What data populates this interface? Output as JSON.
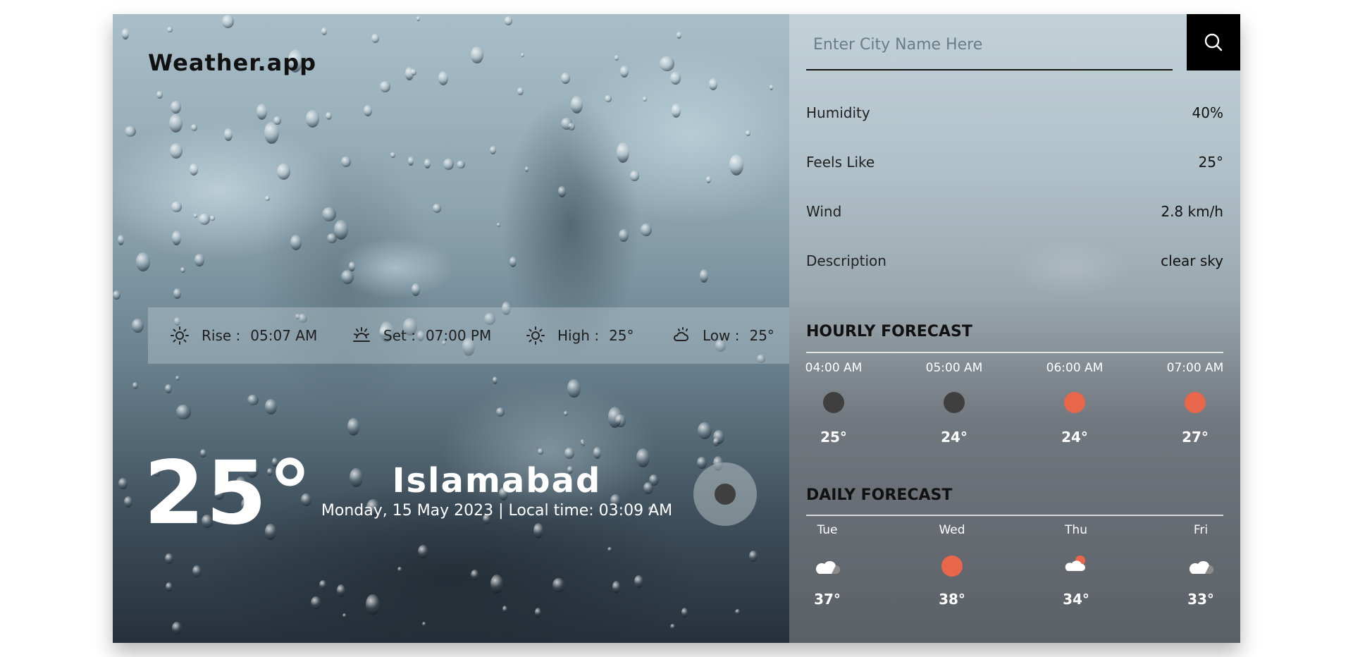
{
  "app": {
    "brand": "Weather.app"
  },
  "search": {
    "placeholder": "Enter City Name Here",
    "button_icon": "search-icon"
  },
  "stats": {
    "rise_label": "Rise :",
    "rise_value": "05:07 AM",
    "set_label": "Set :",
    "set_value": "07:00 PM",
    "high_label": "High :",
    "high_value": "25°",
    "low_label": "Low :",
    "low_value": "25°"
  },
  "current": {
    "temperature": "25°",
    "city": "Islamabad",
    "datetime": "Monday, 15 May 2023 | Local time: 03:09 AM",
    "icon": "dark-dot-icon"
  },
  "details": [
    {
      "label": "Humidity",
      "value": "40%"
    },
    {
      "label": "Feels Like",
      "value": "25°"
    },
    {
      "label": "Wind",
      "value": "2.8 km/h"
    },
    {
      "label": "Description",
      "value": "clear sky"
    }
  ],
  "hourly": {
    "title": "HOURLY FORECAST",
    "items": [
      {
        "time": "04:00 AM",
        "temp": "25°",
        "icon": "dark-dot"
      },
      {
        "time": "05:00 AM",
        "temp": "24°",
        "icon": "dark-dot"
      },
      {
        "time": "06:00 AM",
        "temp": "24°",
        "icon": "sun-dot"
      },
      {
        "time": "07:00 AM",
        "temp": "27°",
        "icon": "sun-dot"
      }
    ]
  },
  "daily": {
    "title": "DAILY FORECAST",
    "items": [
      {
        "day": "Tue",
        "temp": "37°",
        "icon": "cloud"
      },
      {
        "day": "Wed",
        "temp": "38°",
        "icon": "sun-dot"
      },
      {
        "day": "Thu",
        "temp": "34°",
        "icon": "cloud-sun"
      },
      {
        "day": "Fri",
        "temp": "33°",
        "icon": "cloud"
      }
    ]
  },
  "colors": {
    "accent": "#e8664a",
    "dark_icon": "#3f3f3f"
  }
}
